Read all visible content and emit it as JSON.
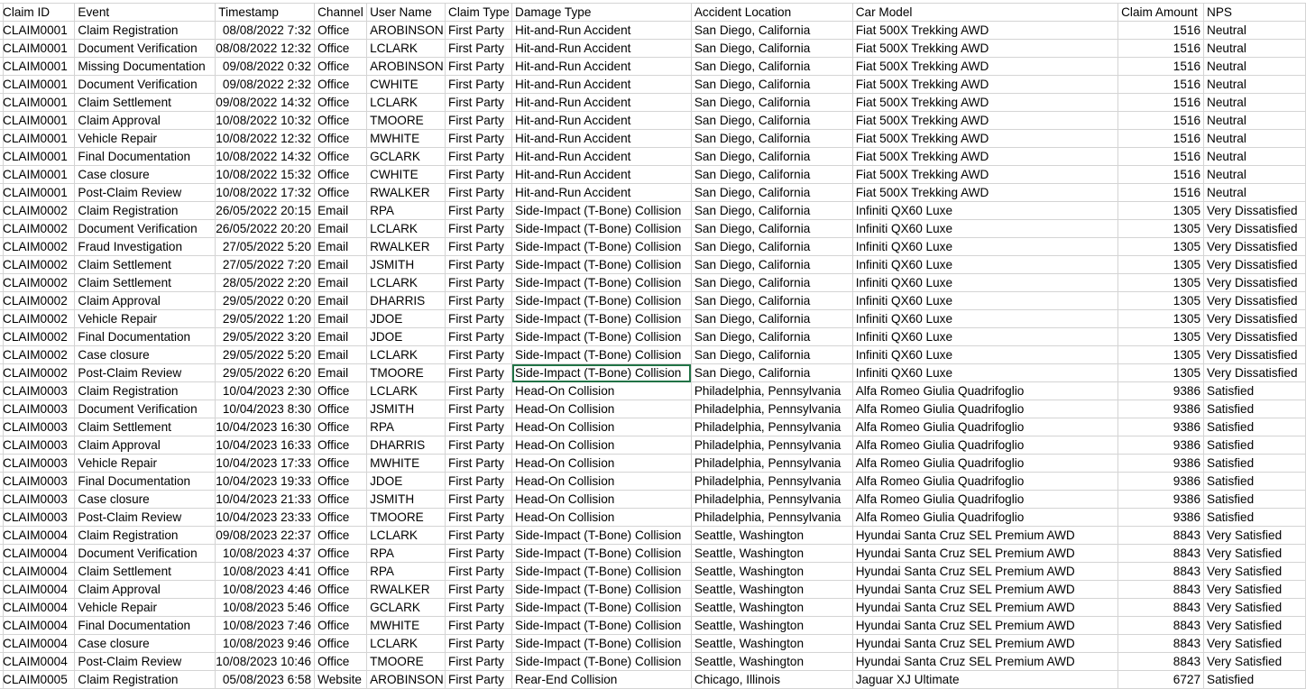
{
  "columns": [
    "Claim ID",
    "Event",
    "Timestamp",
    "Channel",
    "User Name",
    "Claim Type",
    "Damage Type",
    "Accident Location",
    "Car Model",
    "Claim Amount",
    "NPS"
  ],
  "rows": [
    [
      "CLAIM0001",
      "Claim Registration",
      "08/08/2022 7:32",
      "Office",
      "AROBINSON",
      "First Party",
      "Hit-and-Run Accident",
      "San Diego, California",
      "Fiat 500X Trekking AWD",
      "1516",
      "Neutral"
    ],
    [
      "CLAIM0001",
      "Document Verification",
      "08/08/2022 12:32",
      "Office",
      "LCLARK",
      "First Party",
      "Hit-and-Run Accident",
      "San Diego, California",
      "Fiat 500X Trekking AWD",
      "1516",
      "Neutral"
    ],
    [
      "CLAIM0001",
      "Missing Documentation",
      "09/08/2022 0:32",
      "Office",
      "AROBINSON",
      "First Party",
      "Hit-and-Run Accident",
      "San Diego, California",
      "Fiat 500X Trekking AWD",
      "1516",
      "Neutral"
    ],
    [
      "CLAIM0001",
      "Document Verification",
      "09/08/2022 2:32",
      "Office",
      "CWHITE",
      "First Party",
      "Hit-and-Run Accident",
      "San Diego, California",
      "Fiat 500X Trekking AWD",
      "1516",
      "Neutral"
    ],
    [
      "CLAIM0001",
      "Claim Settlement",
      "09/08/2022 14:32",
      "Office",
      "LCLARK",
      "First Party",
      "Hit-and-Run Accident",
      "San Diego, California",
      "Fiat 500X Trekking AWD",
      "1516",
      "Neutral"
    ],
    [
      "CLAIM0001",
      "Claim Approval",
      "10/08/2022 10:32",
      "Office",
      "TMOORE",
      "First Party",
      "Hit-and-Run Accident",
      "San Diego, California",
      "Fiat 500X Trekking AWD",
      "1516",
      "Neutral"
    ],
    [
      "CLAIM0001",
      "Vehicle Repair",
      "10/08/2022 12:32",
      "Office",
      "MWHITE",
      "First Party",
      "Hit-and-Run Accident",
      "San Diego, California",
      "Fiat 500X Trekking AWD",
      "1516",
      "Neutral"
    ],
    [
      "CLAIM0001",
      "Final Documentation",
      "10/08/2022 14:32",
      "Office",
      "GCLARK",
      "First Party",
      "Hit-and-Run Accident",
      "San Diego, California",
      "Fiat 500X Trekking AWD",
      "1516",
      "Neutral"
    ],
    [
      "CLAIM0001",
      "Case closure",
      "10/08/2022 15:32",
      "Office",
      "CWHITE",
      "First Party",
      "Hit-and-Run Accident",
      "San Diego, California",
      "Fiat 500X Trekking AWD",
      "1516",
      "Neutral"
    ],
    [
      "CLAIM0001",
      "Post-Claim Review",
      "10/08/2022 17:32",
      "Office",
      "RWALKER",
      "First Party",
      "Hit-and-Run Accident",
      "San Diego, California",
      "Fiat 500X Trekking AWD",
      "1516",
      "Neutral"
    ],
    [
      "CLAIM0002",
      "Claim Registration",
      "26/05/2022 20:15",
      "Email",
      "RPA",
      "First Party",
      "Side-Impact (T-Bone) Collision",
      "San Diego, California",
      "Infiniti QX60 Luxe",
      "1305",
      "Very Dissatisfied"
    ],
    [
      "CLAIM0002",
      "Document Verification",
      "26/05/2022 20:20",
      "Email",
      "LCLARK",
      "First Party",
      "Side-Impact (T-Bone) Collision",
      "San Diego, California",
      "Infiniti QX60 Luxe",
      "1305",
      "Very Dissatisfied"
    ],
    [
      "CLAIM0002",
      "Fraud Investigation",
      "27/05/2022 5:20",
      "Email",
      "RWALKER",
      "First Party",
      "Side-Impact (T-Bone) Collision",
      "San Diego, California",
      "Infiniti QX60 Luxe",
      "1305",
      "Very Dissatisfied"
    ],
    [
      "CLAIM0002",
      "Claim Settlement",
      "27/05/2022 7:20",
      "Email",
      "JSMITH",
      "First Party",
      "Side-Impact (T-Bone) Collision",
      "San Diego, California",
      "Infiniti QX60 Luxe",
      "1305",
      "Very Dissatisfied"
    ],
    [
      "CLAIM0002",
      "Claim Settlement",
      "28/05/2022 2:20",
      "Email",
      "LCLARK",
      "First Party",
      "Side-Impact (T-Bone) Collision",
      "San Diego, California",
      "Infiniti QX60 Luxe",
      "1305",
      "Very Dissatisfied"
    ],
    [
      "CLAIM0002",
      "Claim Approval",
      "29/05/2022 0:20",
      "Email",
      "DHARRIS",
      "First Party",
      "Side-Impact (T-Bone) Collision",
      "San Diego, California",
      "Infiniti QX60 Luxe",
      "1305",
      "Very Dissatisfied"
    ],
    [
      "CLAIM0002",
      "Vehicle Repair",
      "29/05/2022 1:20",
      "Email",
      "JDOE",
      "First Party",
      "Side-Impact (T-Bone) Collision",
      "San Diego, California",
      "Infiniti QX60 Luxe",
      "1305",
      "Very Dissatisfied"
    ],
    [
      "CLAIM0002",
      "Final Documentation",
      "29/05/2022 3:20",
      "Email",
      "JDOE",
      "First Party",
      "Side-Impact (T-Bone) Collision",
      "San Diego, California",
      "Infiniti QX60 Luxe",
      "1305",
      "Very Dissatisfied"
    ],
    [
      "CLAIM0002",
      "Case closure",
      "29/05/2022 5:20",
      "Email",
      "LCLARK",
      "First Party",
      "Side-Impact (T-Bone) Collision",
      "San Diego, California",
      "Infiniti QX60 Luxe",
      "1305",
      "Very Dissatisfied"
    ],
    [
      "CLAIM0002",
      "Post-Claim Review",
      "29/05/2022 6:20",
      "Email",
      "TMOORE",
      "First Party",
      "Side-Impact (T-Bone) Collision",
      "San Diego, California",
      "Infiniti QX60 Luxe",
      "1305",
      "Very Dissatisfied"
    ],
    [
      "CLAIM0003",
      "Claim Registration",
      "10/04/2023 2:30",
      "Office",
      "LCLARK",
      "First Party",
      "Head-On Collision",
      "Philadelphia, Pennsylvania",
      "Alfa Romeo Giulia Quadrifoglio",
      "9386",
      "Satisfied"
    ],
    [
      "CLAIM0003",
      "Document Verification",
      "10/04/2023 8:30",
      "Office",
      "JSMITH",
      "First Party",
      "Head-On Collision",
      "Philadelphia, Pennsylvania",
      "Alfa Romeo Giulia Quadrifoglio",
      "9386",
      "Satisfied"
    ],
    [
      "CLAIM0003",
      "Claim Settlement",
      "10/04/2023 16:30",
      "Office",
      "RPA",
      "First Party",
      "Head-On Collision",
      "Philadelphia, Pennsylvania",
      "Alfa Romeo Giulia Quadrifoglio",
      "9386",
      "Satisfied"
    ],
    [
      "CLAIM0003",
      "Claim Approval",
      "10/04/2023 16:33",
      "Office",
      "DHARRIS",
      "First Party",
      "Head-On Collision",
      "Philadelphia, Pennsylvania",
      "Alfa Romeo Giulia Quadrifoglio",
      "9386",
      "Satisfied"
    ],
    [
      "CLAIM0003",
      "Vehicle Repair",
      "10/04/2023 17:33",
      "Office",
      "MWHITE",
      "First Party",
      "Head-On Collision",
      "Philadelphia, Pennsylvania",
      "Alfa Romeo Giulia Quadrifoglio",
      "9386",
      "Satisfied"
    ],
    [
      "CLAIM0003",
      "Final Documentation",
      "10/04/2023 19:33",
      "Office",
      "JDOE",
      "First Party",
      "Head-On Collision",
      "Philadelphia, Pennsylvania",
      "Alfa Romeo Giulia Quadrifoglio",
      "9386",
      "Satisfied"
    ],
    [
      "CLAIM0003",
      "Case closure",
      "10/04/2023 21:33",
      "Office",
      "JSMITH",
      "First Party",
      "Head-On Collision",
      "Philadelphia, Pennsylvania",
      "Alfa Romeo Giulia Quadrifoglio",
      "9386",
      "Satisfied"
    ],
    [
      "CLAIM0003",
      "Post-Claim Review",
      "10/04/2023 23:33",
      "Office",
      "TMOORE",
      "First Party",
      "Head-On Collision",
      "Philadelphia, Pennsylvania",
      "Alfa Romeo Giulia Quadrifoglio",
      "9386",
      "Satisfied"
    ],
    [
      "CLAIM0004",
      "Claim Registration",
      "09/08/2023 22:37",
      "Office",
      "LCLARK",
      "First Party",
      "Side-Impact (T-Bone) Collision",
      "Seattle, Washington",
      "Hyundai Santa Cruz SEL Premium AWD",
      "8843",
      "Very Satisfied"
    ],
    [
      "CLAIM0004",
      "Document Verification",
      "10/08/2023 4:37",
      "Office",
      "RPA",
      "First Party",
      "Side-Impact (T-Bone) Collision",
      "Seattle, Washington",
      "Hyundai Santa Cruz SEL Premium AWD",
      "8843",
      "Very Satisfied"
    ],
    [
      "CLAIM0004",
      "Claim Settlement",
      "10/08/2023 4:41",
      "Office",
      "RPA",
      "First Party",
      "Side-Impact (T-Bone) Collision",
      "Seattle, Washington",
      "Hyundai Santa Cruz SEL Premium AWD",
      "8843",
      "Very Satisfied"
    ],
    [
      "CLAIM0004",
      "Claim Approval",
      "10/08/2023 4:46",
      "Office",
      "RWALKER",
      "First Party",
      "Side-Impact (T-Bone) Collision",
      "Seattle, Washington",
      "Hyundai Santa Cruz SEL Premium AWD",
      "8843",
      "Very Satisfied"
    ],
    [
      "CLAIM0004",
      "Vehicle Repair",
      "10/08/2023 5:46",
      "Office",
      "GCLARK",
      "First Party",
      "Side-Impact (T-Bone) Collision",
      "Seattle, Washington",
      "Hyundai Santa Cruz SEL Premium AWD",
      "8843",
      "Very Satisfied"
    ],
    [
      "CLAIM0004",
      "Final Documentation",
      "10/08/2023 7:46",
      "Office",
      "MWHITE",
      "First Party",
      "Side-Impact (T-Bone) Collision",
      "Seattle, Washington",
      "Hyundai Santa Cruz SEL Premium AWD",
      "8843",
      "Very Satisfied"
    ],
    [
      "CLAIM0004",
      "Case closure",
      "10/08/2023 9:46",
      "Office",
      "LCLARK",
      "First Party",
      "Side-Impact (T-Bone) Collision",
      "Seattle, Washington",
      "Hyundai Santa Cruz SEL Premium AWD",
      "8843",
      "Very Satisfied"
    ],
    [
      "CLAIM0004",
      "Post-Claim Review",
      "10/08/2023 10:46",
      "Office",
      "TMOORE",
      "First Party",
      "Side-Impact (T-Bone) Collision",
      "Seattle, Washington",
      "Hyundai Santa Cruz SEL Premium AWD",
      "8843",
      "Very Satisfied"
    ],
    [
      "CLAIM0005",
      "Claim Registration",
      "05/08/2023 6:58",
      "Website",
      "AROBINSON",
      "First Party",
      "Rear-End Collision",
      "Chicago, Illinois",
      "Jaguar XJ Ultimate",
      "6727",
      "Satisfied"
    ]
  ],
  "selected_cell": {
    "row": 19,
    "col": 6
  }
}
